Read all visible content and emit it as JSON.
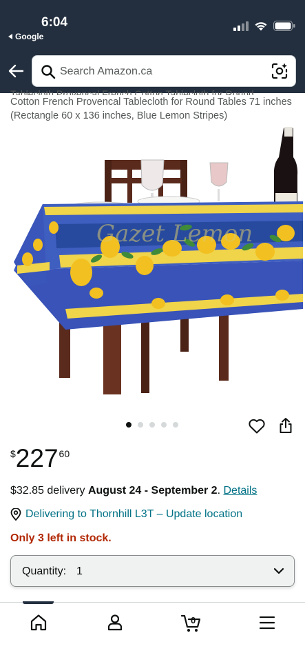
{
  "status": {
    "time": "6:04",
    "back_app": "Google"
  },
  "search": {
    "placeholder": "Search Amazon.ca"
  },
  "product": {
    "title_cut": "Tablecloth Provencal French Cotton Tablecloth for Round",
    "title": "Cotton French Provencal Tablecloth for Round Tables 71 inches (Rectangle 60 x 136 inches, Blue Lemon Stripes)",
    "watermark": "Gazet Lemon"
  },
  "carousel": {
    "count": 5,
    "active": 0
  },
  "price": {
    "symbol": "$",
    "whole": "227",
    "fraction": "60"
  },
  "delivery": {
    "fee_text": "$32.85 delivery",
    "dates": "August 24 - September 2",
    "period": ".",
    "details_link": "Details"
  },
  "location": {
    "text": "Delivering to Thornhill L3T – Update location"
  },
  "stock": {
    "text": "Only 3 left in stock."
  },
  "quantity": {
    "label": "Quantity:",
    "value": "1"
  },
  "nav": {
    "cart_count": "0"
  },
  "colors": {
    "link": "#007185",
    "stock": "#b12704",
    "header": "#232f3e"
  },
  "icons": [
    "back-arrow-icon",
    "search-icon",
    "camera-lens-icon",
    "heart-icon",
    "share-icon",
    "location-pin-icon",
    "chevron-down-icon",
    "home-icon",
    "account-icon",
    "cart-icon",
    "menu-icon"
  ]
}
